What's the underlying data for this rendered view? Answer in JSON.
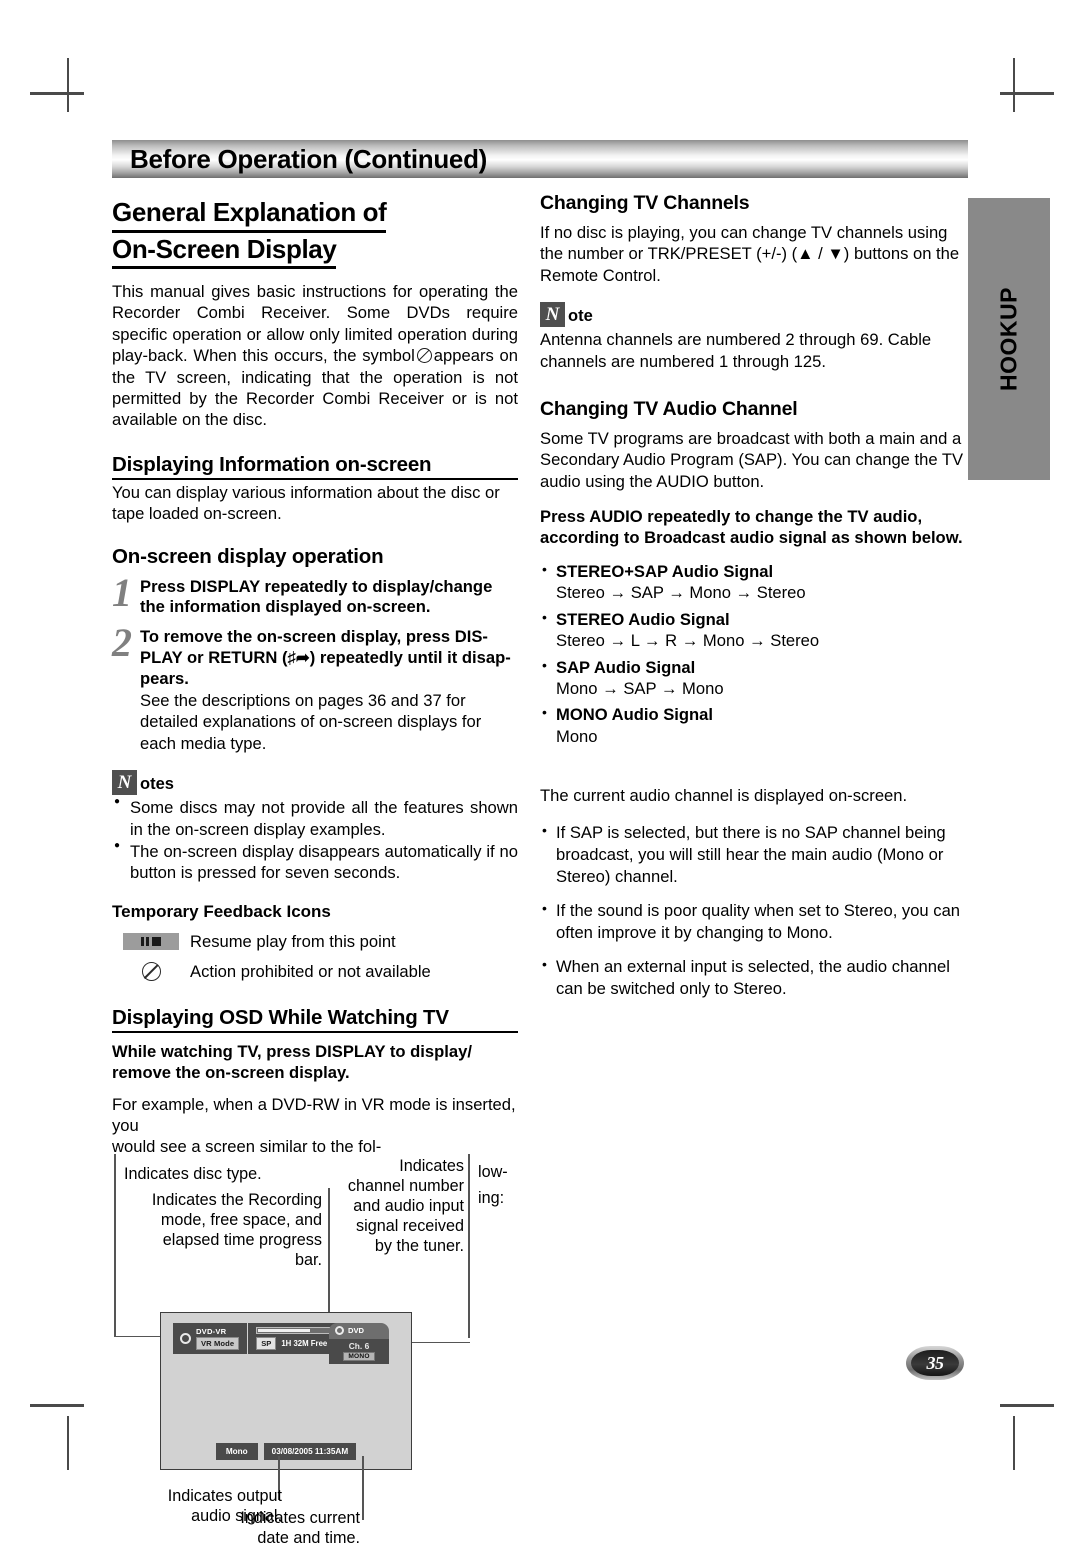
{
  "banner": {
    "title": "Before Operation (Continued)"
  },
  "side_tab": {
    "label": "HOOKUP"
  },
  "page_number": "35",
  "left": {
    "main_heading_line1": "General Explanation of",
    "main_heading_line2": "On-Screen Display",
    "intro_part1": "This manual gives basic instructions for operating the Recorder Combi Receiver. Some DVDs require specific operation or allow only limited operation during play-back. When this occurs, the symbol",
    "intro_part2": "appears on the TV screen, indicating that the operation is not permitted by the Recorder Combi Receiver or is not available on the disc.",
    "section_display_info": "Displaying Information on-screen",
    "display_info_body": "You can display various information about the disc or tape loaded on-screen.",
    "section_osd_operation": "On-screen display operation",
    "steps": [
      {
        "number": "1",
        "bold": "Press DISPLAY repeatedly to display/change the information displayed on-screen.",
        "plain": ""
      },
      {
        "number": "2",
        "bold_a": "To remove the on-screen display, press DIS-PLAY or RETURN (",
        "bold_b": ") repeatedly until it disap-pears.",
        "plain": "See the descriptions on pages 36 and 37 for detailed explanations of on-screen displays for each media type."
      }
    ],
    "notes_label": "otes",
    "notes_glyph": "N",
    "notes": [
      "Some discs may not provide all the features shown in the on-screen display examples.",
      "The on-screen display disappears automatically if no button is pressed for seven seconds."
    ],
    "feedback_heading": "Temporary Feedback Icons",
    "feedback_rows": [
      {
        "icon": "resume-play-icon",
        "label": "Resume play from this point"
      },
      {
        "icon": "prohibited-icon",
        "label": "Action prohibited or not available"
      }
    ],
    "section_osd_tv": "Displaying OSD While Watching TV",
    "osd_tv_bold": "While watching TV, press DISPLAY to display/ remove the on-screen display.",
    "osd_tv_body_a": "For example, when a DVD-RW in VR mode is inserted, you",
    "osd_tv_body_b": "would see a screen similar to the fol-",
    "osd_tv_body_c": "low-",
    "osd_tv_body_d": "ing:",
    "callouts": {
      "disc_type": "Indicates disc type.",
      "recording_mode": "Indicates the Recording mode, free space, and elapsed time progress bar.",
      "channel": "Indicates channel number and audio input signal received by the tuner.",
      "output_audio": "Indicates output audio signal.",
      "date_time": "Indicates current date and time."
    },
    "osd_screen": {
      "disc_name": "DVD-VR",
      "disc_mode": "VR Mode",
      "rec_mode": "SP",
      "rec_free": "1H 32M Free",
      "tuner_source": "DVD",
      "tuner_channel": "Ch. 6",
      "tuner_audio": "MONO",
      "output_audio": "Mono",
      "datetime": "03/08/2005 11:35AM"
    }
  },
  "right": {
    "heading_channels": "Changing TV Channels",
    "channels_body": "If no disc is playing, you can change TV channels using the number or TRK/PRESET (+/-) (▲ / ▼) buttons on the Remote Control.",
    "note_glyph": "N",
    "note_label": "ote",
    "note_body": "Antenna channels are numbered 2 through 69. Cable channels are numbered 1 through 125.",
    "heading_audio": "Changing TV Audio Channel",
    "audio_body": "Some TV programs are broadcast with both a main and a Secondary Audio Program (SAP). You can change the TV audio using the AUDIO button.",
    "audio_bold": "Press AUDIO repeatedly to change the TV audio, according to Broadcast audio signal as shown below.",
    "signals": [
      {
        "title": "STEREO+SAP Audio Signal",
        "chain": "Stereo → SAP → Mono → Stereo"
      },
      {
        "title": "STEREO Audio Signal",
        "chain": "Stereo → L → R → Mono → Stereo"
      },
      {
        "title": "SAP Audio Signal",
        "chain": "Mono → SAP → Mono"
      },
      {
        "title": "MONO Audio Signal",
        "chain": "Mono"
      }
    ],
    "current_channel_note": "The current audio channel is displayed on-screen.",
    "tips": [
      "If SAP is selected, but there is no SAP channel being broadcast, you will still hear the main audio (Mono or Stereo) channel.",
      "If the sound is poor quality when set to Stereo, you can often improve it by changing to Mono.",
      "When an external input is selected, the audio channel can be switched only to Stereo."
    ]
  }
}
